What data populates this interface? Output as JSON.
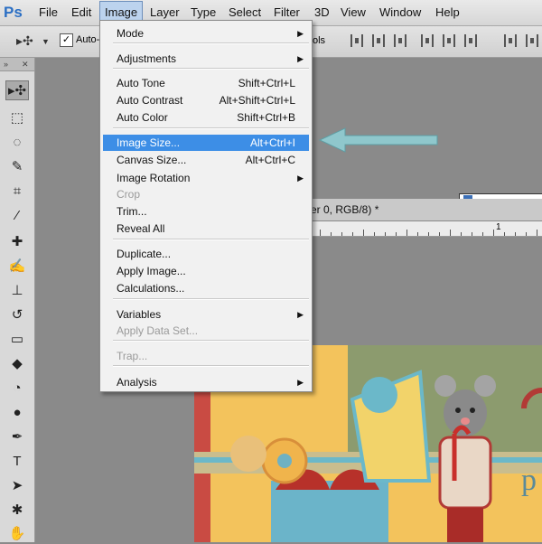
{
  "app": {
    "logo": "Ps"
  },
  "menubar": {
    "items": [
      "File",
      "Edit",
      "Image",
      "Layer",
      "Type",
      "Select",
      "Filter",
      "3D",
      "View",
      "Window",
      "Help"
    ],
    "active_index": 2
  },
  "options_bar": {
    "auto_select_label": "Auto-",
    "auto_select_checked": true,
    "controls_label": "ols"
  },
  "document": {
    "tab_title": "er 0, RGB/8) *",
    "ruler_mark": "1"
  },
  "image_menu": {
    "items": [
      {
        "label": "Mode",
        "shortcut": "",
        "submenu": true,
        "enabled": true,
        "highlighted": false
      },
      {
        "separator": true
      },
      {
        "label": "Adjustments",
        "shortcut": "",
        "submenu": true,
        "enabled": true,
        "highlighted": false
      },
      {
        "separator": true
      },
      {
        "label": "Auto Tone",
        "shortcut": "Shift+Ctrl+L",
        "submenu": false,
        "enabled": true,
        "highlighted": false
      },
      {
        "label": "Auto Contrast",
        "shortcut": "Alt+Shift+Ctrl+L",
        "submenu": false,
        "enabled": true,
        "highlighted": false
      },
      {
        "label": "Auto Color",
        "shortcut": "Shift+Ctrl+B",
        "submenu": false,
        "enabled": true,
        "highlighted": false
      },
      {
        "separator": true
      },
      {
        "label": "Image Size...",
        "shortcut": "Alt+Ctrl+I",
        "submenu": false,
        "enabled": true,
        "highlighted": true
      },
      {
        "label": "Canvas Size...",
        "shortcut": "Alt+Ctrl+C",
        "submenu": false,
        "enabled": true,
        "highlighted": false
      },
      {
        "label": "Image Rotation",
        "shortcut": "",
        "submenu": true,
        "enabled": true,
        "highlighted": false
      },
      {
        "label": "Crop",
        "shortcut": "",
        "submenu": false,
        "enabled": false,
        "highlighted": false
      },
      {
        "label": "Trim...",
        "shortcut": "",
        "submenu": false,
        "enabled": true,
        "highlighted": false
      },
      {
        "label": "Reveal All",
        "shortcut": "",
        "submenu": false,
        "enabled": true,
        "highlighted": false
      },
      {
        "separator": true
      },
      {
        "label": "Duplicate...",
        "shortcut": "",
        "submenu": false,
        "enabled": true,
        "highlighted": false
      },
      {
        "label": "Apply Image...",
        "shortcut": "",
        "submenu": false,
        "enabled": true,
        "highlighted": false
      },
      {
        "label": "Calculations...",
        "shortcut": "",
        "submenu": false,
        "enabled": true,
        "highlighted": false
      },
      {
        "separator": true
      },
      {
        "label": "Variables",
        "shortcut": "",
        "submenu": true,
        "enabled": true,
        "highlighted": false
      },
      {
        "label": "Apply Data Set...",
        "shortcut": "",
        "submenu": false,
        "enabled": false,
        "highlighted": false
      },
      {
        "separator": true
      },
      {
        "label": "Trap...",
        "shortcut": "",
        "submenu": false,
        "enabled": false,
        "highlighted": false
      },
      {
        "separator": true
      },
      {
        "label": "Analysis",
        "shortcut": "",
        "submenu": true,
        "enabled": true,
        "highlighted": false
      }
    ]
  },
  "tools": [
    {
      "name": "move-tool",
      "glyph": "▸✣",
      "selected": true
    },
    {
      "name": "marquee-tool",
      "glyph": "⬚",
      "selected": false
    },
    {
      "name": "lasso-tool",
      "glyph": "◌",
      "selected": false
    },
    {
      "name": "quick-selection-tool",
      "glyph": "✎",
      "selected": false
    },
    {
      "name": "crop-tool",
      "glyph": "⌗",
      "selected": false
    },
    {
      "name": "eyedropper-tool",
      "glyph": "⁄",
      "selected": false
    },
    {
      "name": "healing-brush-tool",
      "glyph": "✚",
      "selected": false
    },
    {
      "name": "brush-tool",
      "glyph": "✍",
      "selected": false
    },
    {
      "name": "clone-stamp-tool",
      "glyph": "⊥",
      "selected": false
    },
    {
      "name": "history-brush-tool",
      "glyph": "↺",
      "selected": false
    },
    {
      "name": "eraser-tool",
      "glyph": "▭",
      "selected": false
    },
    {
      "name": "paint-bucket-tool",
      "glyph": "◆",
      "selected": false
    },
    {
      "name": "blur-tool",
      "glyph": "◔",
      "selected": false
    },
    {
      "name": "dodge-tool",
      "glyph": "●",
      "selected": false
    },
    {
      "name": "pen-tool",
      "glyph": "✒",
      "selected": false
    },
    {
      "name": "type-tool",
      "glyph": "T",
      "selected": false
    },
    {
      "name": "path-selection-tool",
      "glyph": "➤",
      "selected": false
    },
    {
      "name": "shape-tool",
      "glyph": "✱",
      "selected": false
    },
    {
      "name": "hand-tool",
      "glyph": "✋",
      "selected": false
    }
  ],
  "colors": {
    "menu_highlight": "#3d8ee6",
    "arrow": "#8fc7cc",
    "logo": "#2b6fc4"
  }
}
